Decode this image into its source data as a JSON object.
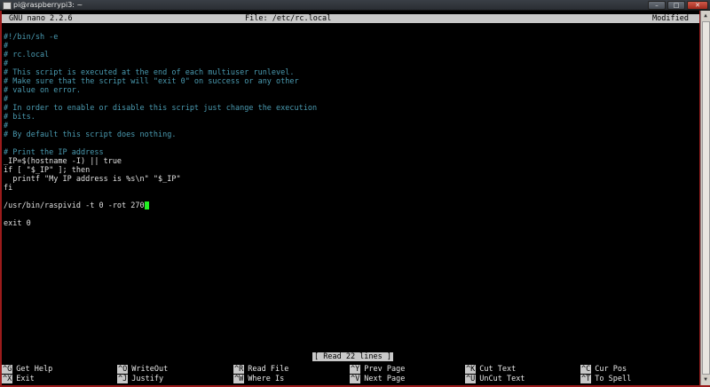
{
  "window": {
    "title": "pi@raspberrypi3: ~"
  },
  "nano": {
    "version": "GNU nano 2.2.6",
    "file": "File: /etc/rc.local",
    "state": "Modified"
  },
  "content": {
    "lines": [
      "#!/bin/sh -e",
      "#",
      "# rc.local",
      "#",
      "# This script is executed at the end of each multiuser runlevel.",
      "# Make sure that the script will \"exit 0\" on success or any other",
      "# value on error.",
      "#",
      "# In order to enable or disable this script just change the execution",
      "# bits.",
      "#",
      "# By default this script does nothing.",
      "",
      "# Print the IP address",
      "_IP=$(hostname -I) || true",
      "if [ \"$_IP\" ]; then",
      "  printf \"My IP address is %s\\n\" \"$_IP\"",
      "fi",
      "",
      "/usr/bin/raspivid -t 0 -rot 270",
      "",
      "exit 0"
    ]
  },
  "status": {
    "message": "[ Read 22 lines ]"
  },
  "shortcuts": [
    {
      "key": "^G",
      "label": "Get Help"
    },
    {
      "key": "^O",
      "label": "WriteOut"
    },
    {
      "key": "^R",
      "label": "Read File"
    },
    {
      "key": "^Y",
      "label": "Prev Page"
    },
    {
      "key": "^K",
      "label": "Cut Text"
    },
    {
      "key": "^C",
      "label": "Cur Pos"
    },
    {
      "key": "^X",
      "label": "Exit"
    },
    {
      "key": "^J",
      "label": "Justify"
    },
    {
      "key": "^W",
      "label": "Where Is"
    },
    {
      "key": "^V",
      "label": "Next Page"
    },
    {
      "key": "^U",
      "label": "UnCut Text"
    },
    {
      "key": "^T",
      "label": "To Spell"
    }
  ],
  "icons": {
    "minimize": "minimize-icon",
    "maximize": "maximize-icon",
    "close": "close-icon"
  }
}
